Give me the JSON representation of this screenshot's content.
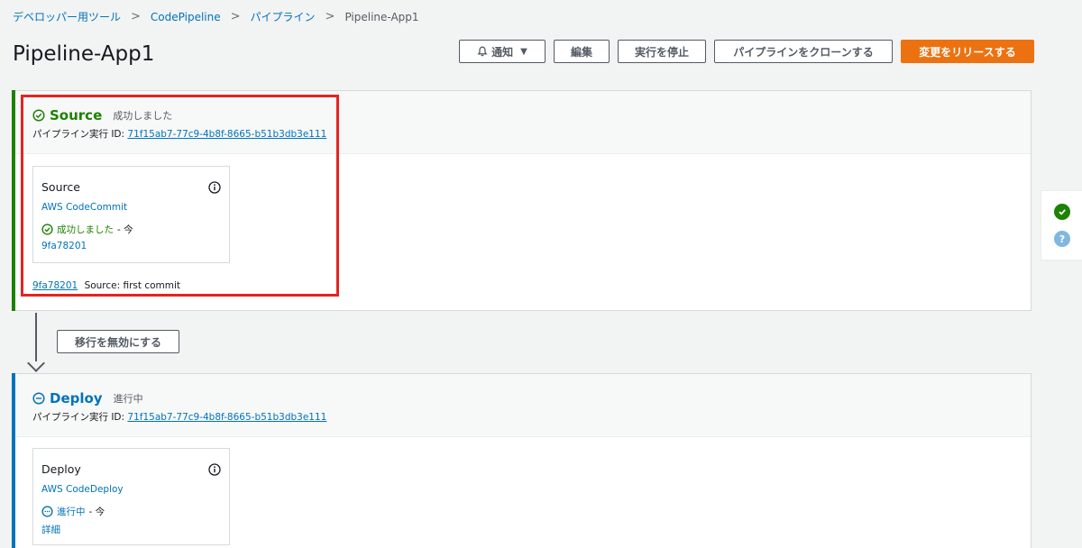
{
  "breadcrumb": {
    "items": [
      "デベロッパー用ツール",
      "CodePipeline",
      "パイプライン"
    ],
    "current": "Pipeline-App1"
  },
  "page": {
    "title": "Pipeline-App1"
  },
  "actions": {
    "notify": "通知",
    "edit": "編集",
    "stop": "実行を停止",
    "clone": "パイプラインをクローンする",
    "release": "変更をリリースする"
  },
  "stages": [
    {
      "name": "Source",
      "status": "成功しました",
      "exec_label": "パイプライン実行 ID:",
      "exec_id": "71f15ab7-77c9-4b8f-8665-b51b3db3e111",
      "color": "#1d8102",
      "action": {
        "name": "Source",
        "provider": "AWS CodeCommit",
        "status": "成功しました",
        "time": "- 今",
        "link": "9fa78201"
      },
      "commit": {
        "id": "9fa78201",
        "message": "Source: first commit"
      }
    },
    {
      "name": "Deploy",
      "status": "進行中",
      "exec_label": "パイプライン実行 ID:",
      "exec_id": "71f15ab7-77c9-4b8f-8665-b51b3db3e111",
      "color": "#0073bb",
      "action": {
        "name": "Deploy",
        "provider": "AWS CodeDeploy",
        "status": "進行中",
        "time": "- 今",
        "link": "詳細"
      }
    }
  ],
  "transition": {
    "button": "移行を無効にする"
  },
  "colors": {
    "success": "#1d8102",
    "in_progress": "#0073bb",
    "primary": "#ec7211",
    "highlight": "#e52322"
  }
}
